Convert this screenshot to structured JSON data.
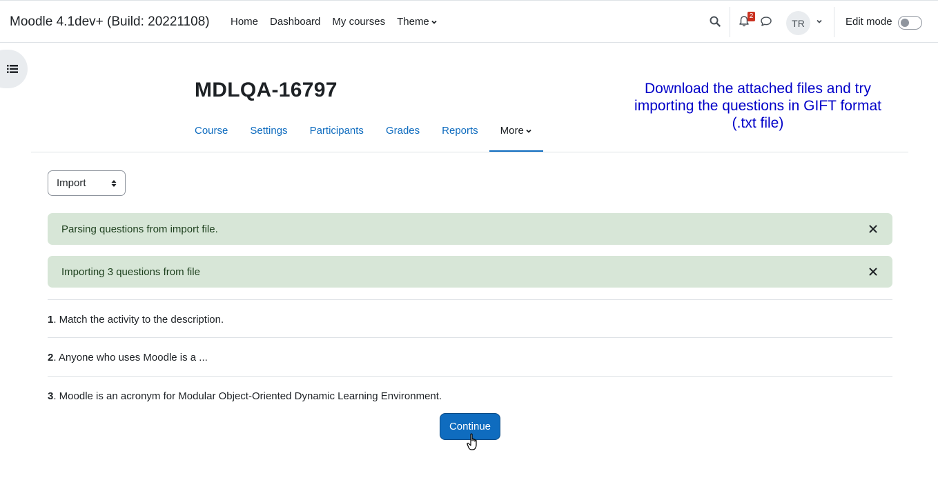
{
  "navbar": {
    "brand": "Moodle 4.1dev+ (Build: 20221108)",
    "links": [
      "Home",
      "Dashboard",
      "My courses",
      "Theme"
    ],
    "notifications_count": "2",
    "avatar_initials": "TR",
    "edit_mode_label": "Edit mode",
    "edit_mode_on": false
  },
  "page": {
    "title": "MDLQA-16797",
    "annotation": "Download the attached files and try importing the questions in GIFT format (.txt file)"
  },
  "secondary_nav": {
    "tabs": [
      "Course",
      "Settings",
      "Participants",
      "Grades",
      "Reports",
      "More"
    ],
    "active": "More"
  },
  "import_select": {
    "value": "Import"
  },
  "alerts": [
    "Parsing questions from import file.",
    "Importing 3 questions from file"
  ],
  "questions": [
    {
      "num": "1",
      "text": ". Match the activity to the description."
    },
    {
      "num": "2",
      "text": ". Anyone who uses Moodle is a ..."
    },
    {
      "num": "3",
      "text": ". Moodle is an acronym for Modular Object-Oriented Dynamic Learning Environment."
    }
  ],
  "continue_label": "Continue",
  "colors": {
    "primary": "#0f6cbf",
    "success_bg": "#d7e6d7",
    "annotation": "#0000c8",
    "badge": "#ca3120"
  }
}
